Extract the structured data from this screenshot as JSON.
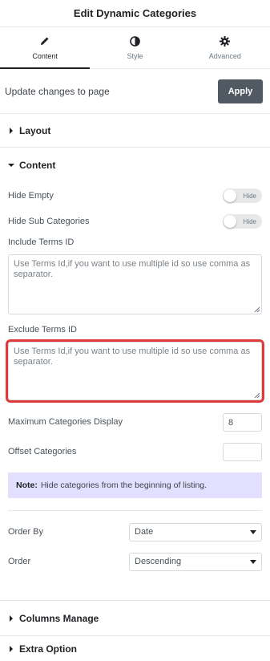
{
  "header": {
    "title": "Edit Dynamic Categories"
  },
  "tabs": [
    {
      "label": "Content",
      "icon": "pencil-icon",
      "active": true
    },
    {
      "label": "Style",
      "icon": "contrast-icon",
      "active": false
    },
    {
      "label": "Advanced",
      "icon": "gear-icon",
      "active": false
    }
  ],
  "apply_bar": {
    "text": "Update changes to page",
    "button": "Apply"
  },
  "sections": {
    "layout": "Layout",
    "content": "Content",
    "columns": "Columns Manage",
    "extra": "Extra Option"
  },
  "controls": {
    "hide_empty": {
      "label": "Hide Empty",
      "state": "Hide"
    },
    "hide_sub": {
      "label": "Hide Sub Categories",
      "state": "Hide"
    },
    "include_terms": {
      "label": "Include Terms ID",
      "placeholder": "Use Terms Id,if you want to use multiple id so use comma as separator."
    },
    "exclude_terms": {
      "label": "Exclude Terms ID",
      "placeholder": "Use Terms Id,if you want to use multiple id so use comma as separator."
    },
    "max_display": {
      "label": "Maximum Categories Display",
      "value": "8"
    },
    "offset": {
      "label": "Offset Categories",
      "value": ""
    },
    "note": {
      "bold": "Note:",
      "text": "Hide categories from the beginning of listing."
    },
    "order_by": {
      "label": "Order By",
      "value": "Date"
    },
    "order": {
      "label": "Order",
      "value": "Descending"
    }
  },
  "colors": {
    "highlight": "#e03a3a",
    "apply_button": "#515962",
    "note_bg": "#e3e0ff"
  }
}
